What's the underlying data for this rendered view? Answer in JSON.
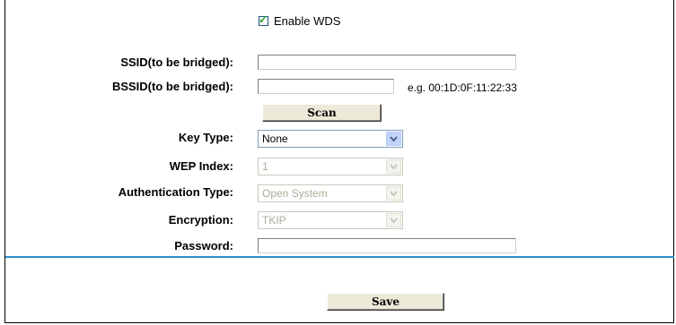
{
  "wds": {
    "enable_label": "Enable WDS",
    "checked": true
  },
  "labels": {
    "ssid": "SSID(to be bridged):",
    "bssid": "BSSID(to be bridged):",
    "key_type": "Key Type:",
    "wep_index": "WEP Index:",
    "auth_type": "Authentication Type:",
    "encryption": "Encryption:",
    "password": "Password:"
  },
  "fields": {
    "ssid_value": "",
    "bssid_value": "",
    "password_value": "",
    "bssid_hint": "e.g. 00:1D:0F:11:22:33"
  },
  "selects": {
    "key_type": "None",
    "wep_index": "1",
    "auth_type": "Open System",
    "encryption": "TKIP"
  },
  "buttons": {
    "scan": "Scan",
    "save": "Save"
  },
  "colors": {
    "divider": "#2f8fc8",
    "check": "#21a121",
    "select_arrow_bg": "#c1d3fb"
  },
  "icons": {
    "checkbox": "check-icon",
    "dropdown": "chevron-down-icon"
  }
}
